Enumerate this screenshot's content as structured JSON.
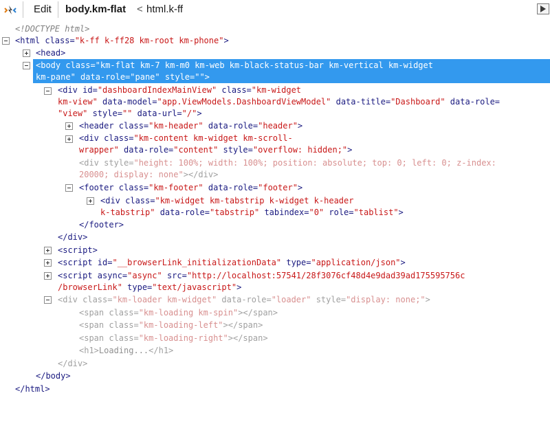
{
  "toolbar": {
    "edit_label": "Edit",
    "crumb_active": "body.km-flat",
    "crumb_sep": "<",
    "crumb_parent": "html.k-ff"
  },
  "tree": {
    "doctype": "<!DOCTYPE html>",
    "html_open": [
      "<html",
      " class=",
      "\"k-ff k-ff28 km-root km-phone\"",
      ">"
    ],
    "head": "<head>",
    "body_l1": [
      "<body",
      " class=",
      "\"km-flat km-7 km-m0 km-web km-black-status-bar km-vertical km-widget"
    ],
    "body_l2": [
      "km-pane\"",
      " data-role=",
      "\"pane\"",
      " style=",
      "\"\"",
      ">"
    ],
    "div_l1": [
      "<div",
      " id=",
      "\"dashboardIndexMainView\"",
      " class=",
      "\"km-widget"
    ],
    "div_l2": [
      "km-view\"",
      " data-model=",
      "\"app.ViewModels.DashboardViewModel\"",
      " data-title=",
      "\"Dashboard\"",
      " data-role=",
      ""
    ],
    "div_l3": [
      "\"view\"",
      " style=",
      "\"\"",
      " data-url=",
      "\"/\"",
      ">"
    ],
    "header": [
      "<header",
      " class=",
      "\"km-header\"",
      " data-role=",
      "\"header\"",
      ">"
    ],
    "content_l1": [
      "<div",
      " class=",
      "\"km-content km-widget km-scroll-"
    ],
    "content_l2": [
      "wrapper\"",
      " data-role=",
      "\"content\"",
      " style=",
      "\"overflow: hidden;\"",
      ">"
    ],
    "dimdiv_l1": [
      "<div",
      " style=",
      "\"height: 100%; width: 100%; position: absolute; top: 0; left: 0; z-index:"
    ],
    "dimdiv_l2": [
      "20000; display: none\"",
      "></div>"
    ],
    "footer": [
      "<footer",
      " class=",
      "\"km-footer\"",
      " data-role=",
      "\"footer\"",
      ">"
    ],
    "tab_l1": [
      "<div",
      " class=",
      "\"km-widget km-tabstrip k-widget k-header"
    ],
    "tab_l2": [
      "k-tabstrip\"",
      " data-role=",
      "\"tabstrip\"",
      " tabindex=",
      "\"0\"",
      " role=",
      "\"tablist\"",
      ">"
    ],
    "footer_close": "</footer>",
    "div_close": "</div>",
    "script1": "<script>",
    "script2": [
      "<script",
      " id=",
      "\"__browserLink_initializationData\"",
      " type=",
      "\"application/json\"",
      ">"
    ],
    "script3_l1": [
      "<script",
      " async=",
      "\"async\"",
      " src=",
      "\"http://localhost:57541/28f3076cf48d4e9dad39ad175595756c"
    ],
    "script3_l2": [
      "/browserLink\"",
      " type=",
      "\"text/javascript\"",
      ">"
    ],
    "loader": [
      "<div",
      " class=",
      "\"km-loader km-widget\"",
      " data-role=",
      "\"loader\"",
      " style=",
      "\"display: none;\"",
      ">"
    ],
    "span1": [
      "<span",
      " class=",
      "\"km-loading km-spin\"",
      "></span>"
    ],
    "span2": [
      "<span",
      " class=",
      "\"km-loading-left\"",
      "></span>"
    ],
    "span3": [
      "<span",
      " class=",
      "\"km-loading-right\"",
      "></span>"
    ],
    "h1": [
      "<h1>",
      "Loading...",
      "</h1>"
    ],
    "loader_close": "</div>",
    "body_close": "</body>",
    "html_close": "</html>"
  }
}
